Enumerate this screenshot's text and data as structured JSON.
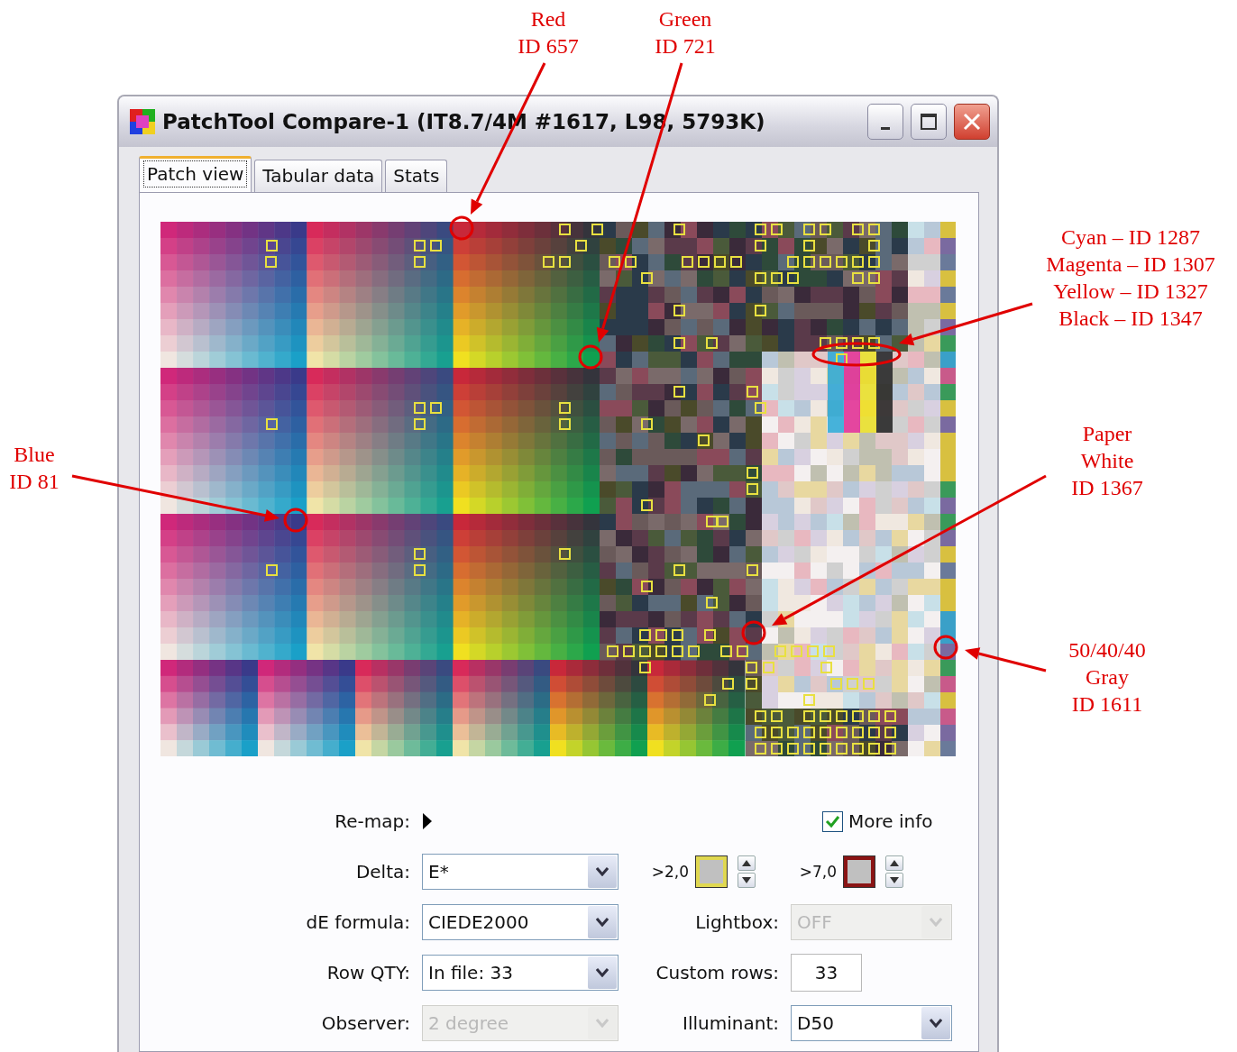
{
  "annotations": [
    {
      "lines": [
        "Red",
        "ID 657"
      ]
    },
    {
      "lines": [
        "Green",
        "ID 721"
      ]
    },
    {
      "lines": [
        "Cyan – ID 1287",
        "Magenta – ID 1307",
        "Yellow – ID 1327",
        "Black – ID 1347"
      ]
    },
    {
      "lines": [
        "Blue",
        "ID 81"
      ]
    },
    {
      "lines": [
        "Paper",
        "White",
        "ID 1367"
      ]
    },
    {
      "lines": [
        "50/40/40",
        "Gray",
        "ID 1611"
      ]
    }
  ],
  "window": {
    "title": "PatchTool Compare-1 (IT8.7/4M #1617, L98, 5793K)"
  },
  "tabs": [
    {
      "label": "Patch view",
      "selected": true
    },
    {
      "label": "Tabular data",
      "selected": false
    },
    {
      "label": "Stats",
      "selected": false
    }
  ],
  "remap": {
    "label": "Re-map:"
  },
  "more_info": {
    "label": "More info",
    "checked": true
  },
  "fields": [
    {
      "label": "Delta:",
      "value": "E*",
      "disabled": false
    },
    {
      "label": "dE formula:",
      "value": "CIEDE2000",
      "disabled": false
    },
    {
      "label": "Row QTY:",
      "value": "In file: 33",
      "disabled": false
    },
    {
      "label": "Observer:",
      "value": "2 degree",
      "disabled": true
    }
  ],
  "thresholds": [
    {
      "label": ">2,0",
      "color": "#e0d850"
    },
    {
      "label": ">7,0",
      "color": "#8a1414"
    }
  ],
  "right_fields": [
    {
      "kind": "dropdown",
      "label": "Lightbox:",
      "value": "OFF",
      "disabled": true
    },
    {
      "kind": "text",
      "label": "Custom rows:",
      "value": "33",
      "disabled": false
    },
    {
      "kind": "dropdown",
      "label": "Illuminant:",
      "value": "D50",
      "disabled": false
    }
  ]
}
